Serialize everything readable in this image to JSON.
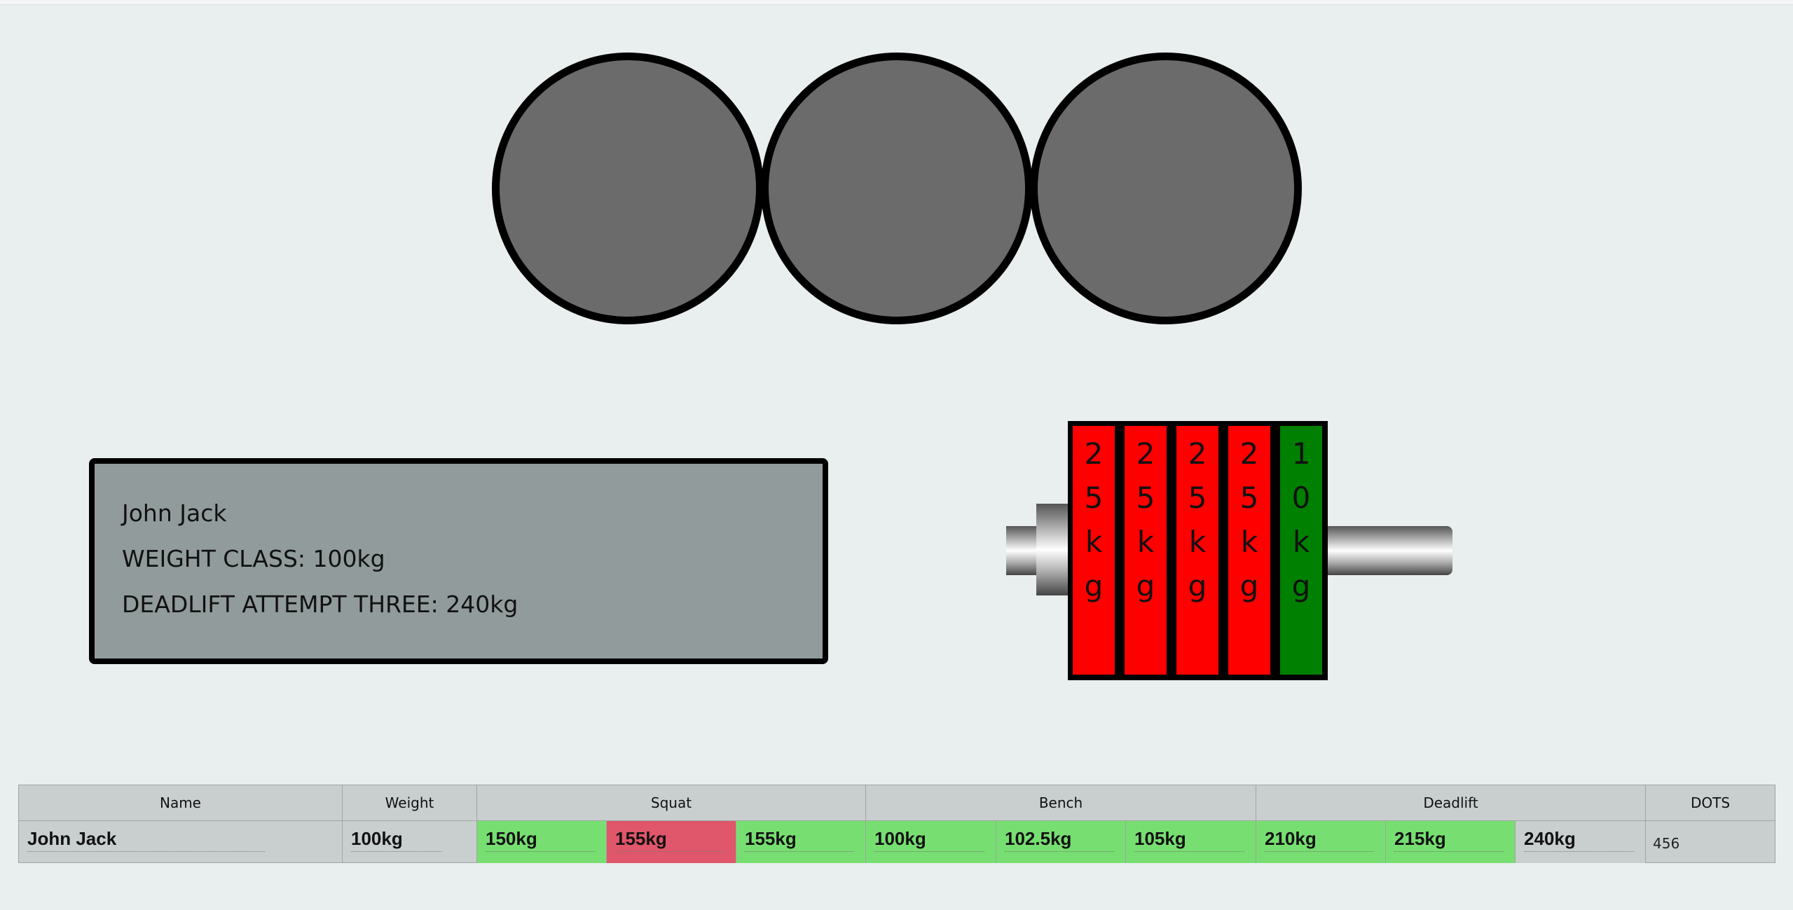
{
  "lights": [
    {
      "state": "none",
      "color": "#6b6b6b"
    },
    {
      "state": "none",
      "color": "#6b6b6b"
    },
    {
      "state": "none",
      "color": "#6b6b6b"
    }
  ],
  "lifter": {
    "name": "John Jack",
    "weight_class": "WEIGHT CLASS: 100kg",
    "attempt": "DEADLIFT ATTEMPT THREE: 240kg"
  },
  "plates": [
    {
      "label": "25kg",
      "chars": [
        "2",
        "5",
        "k",
        "g"
      ],
      "color": "#ff0000"
    },
    {
      "label": "25kg",
      "chars": [
        "2",
        "5",
        "k",
        "g"
      ],
      "color": "#ff0000"
    },
    {
      "label": "25kg",
      "chars": [
        "2",
        "5",
        "k",
        "g"
      ],
      "color": "#ff0000"
    },
    {
      "label": "25kg",
      "chars": [
        "2",
        "5",
        "k",
        "g"
      ],
      "color": "#ff0000"
    },
    {
      "label": "10kg",
      "chars": [
        "1",
        "0",
        "k",
        "g"
      ],
      "color": "#008000"
    }
  ],
  "table": {
    "headers": {
      "name": "Name",
      "weight": "Weight",
      "squat": "Squat",
      "bench": "Bench",
      "deadlift": "Deadlift",
      "dots": "DOTS"
    },
    "row": {
      "name": "John Jack",
      "weight": "100kg",
      "squat": [
        {
          "value": "150kg",
          "result": "good"
        },
        {
          "value": "155kg",
          "result": "bad"
        },
        {
          "value": "155kg",
          "result": "good"
        }
      ],
      "bench": [
        {
          "value": "100kg",
          "result": "good"
        },
        {
          "value": "102.5kg",
          "result": "good"
        },
        {
          "value": "105kg",
          "result": "good"
        }
      ],
      "deadlift": [
        {
          "value": "210kg",
          "result": "good"
        },
        {
          "value": "215kg",
          "result": "good"
        },
        {
          "value": "240kg",
          "result": "pending"
        }
      ],
      "dots": "456"
    }
  },
  "colors": {
    "good": "#77df71",
    "bad": "#e0566a",
    "pending": "#c9cfcf",
    "background": "#e9eeee"
  }
}
